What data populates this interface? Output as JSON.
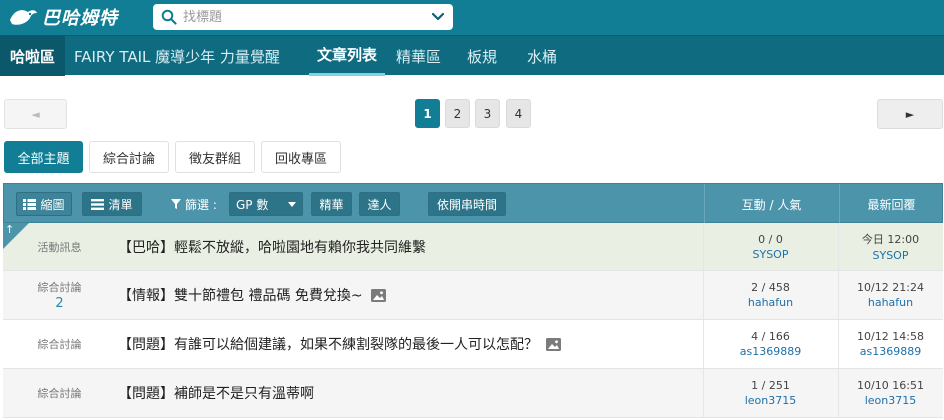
{
  "header": {
    "logo_text": "巴哈姆特",
    "search_placeholder": "找標題"
  },
  "nav": {
    "home": "哈啦區",
    "board": "FAIRY TAIL 魔導少年 力量覺醒",
    "tabs": [
      "文章列表",
      "精華區",
      "板規",
      "水桶"
    ],
    "active_tab": "文章列表"
  },
  "pager": {
    "prev": "◄",
    "next": "►",
    "pages": [
      "1",
      "2",
      "3",
      "4"
    ],
    "current": "1"
  },
  "filter_tabs": [
    "全部主題",
    "綜合討論",
    "徵友群組",
    "回收專區"
  ],
  "table_header": {
    "view_grid": "縮圖",
    "view_list": "清單",
    "filter_label": "篩選 :",
    "sort_select": "GP 數",
    "btn_featured": "精華",
    "btn_expert": "達人",
    "btn_time": "依開串時間",
    "col_interact": "互動 / 人氣",
    "col_reply": "最新回覆"
  },
  "rows": [
    {
      "category": "活動訊息",
      "cat_num": "",
      "title": "【巴哈】輕鬆不放縱，哈啦園地有賴你我共同維繫",
      "has_image": false,
      "interact": "0 / 0",
      "author": "SYSOP",
      "last_time": "今日 12:00",
      "last_user": "SYSOP",
      "pinned": true
    },
    {
      "category": "綜合討論",
      "cat_num": "2",
      "title": "【情報】雙十節禮包 禮品碼 免費兌換~",
      "has_image": true,
      "interact": "2 / 458",
      "author": "hahafun",
      "last_time": "10/12 21:24",
      "last_user": "hahafun",
      "pinned": false
    },
    {
      "category": "綜合討論",
      "cat_num": "",
      "title": "【問題】有誰可以給個建議，如果不練割裂隊的最後一人可以怎配？",
      "has_image": true,
      "interact": "4 / 166",
      "author": "as1369889",
      "last_time": "10/12 14:58",
      "last_user": "as1369889",
      "pinned": false
    },
    {
      "category": "綜合討論",
      "cat_num": "",
      "title": "【問題】補師是不是只有溫蒂啊",
      "has_image": false,
      "interact": "1 / 251",
      "author": "leon3715",
      "last_time": "10/10 16:51",
      "last_user": "leon3715",
      "pinned": false
    }
  ],
  "colors": {
    "brand": "#117e96",
    "nav_bg": "#0e6b80",
    "table_header": "#4c94aa",
    "pinned_row": "#e9f0e3",
    "link": "#1f6fa8"
  }
}
